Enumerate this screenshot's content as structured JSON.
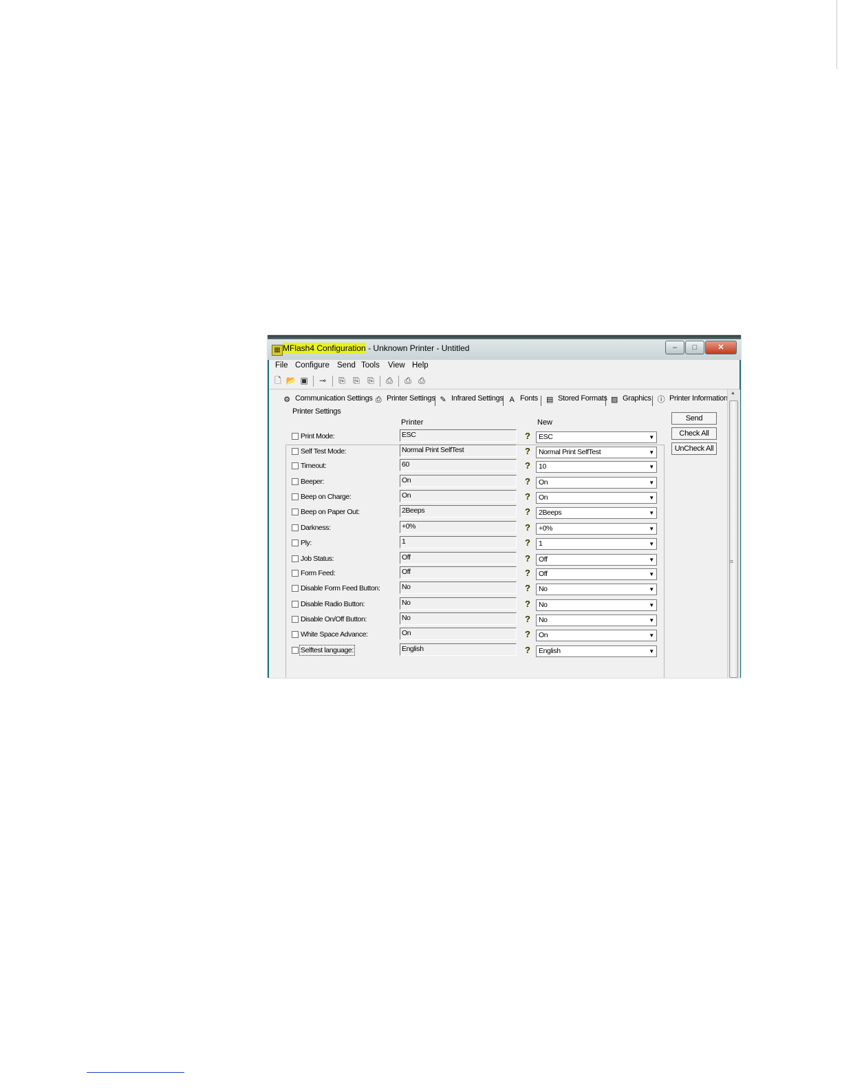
{
  "window": {
    "title_highlight": "MFlash4 Configuration",
    "title_rest": " - Unknown Printer - Untitled",
    "app_icon": "printer-app-icon"
  },
  "menu": [
    "File",
    "Configure",
    "Send",
    "Tools",
    "View",
    "Help"
  ],
  "tabs": [
    {
      "label": "Communication Settings",
      "icon": "communication-icon"
    },
    {
      "label": "Printer Settings",
      "icon": "printer-icon"
    },
    {
      "label": "Infrared Settings",
      "icon": "infrared-icon"
    },
    {
      "label": "Fonts",
      "icon": "fonts-icon"
    },
    {
      "label": "Stored Formats",
      "icon": "stored-formats-icon"
    },
    {
      "label": "Graphics",
      "icon": "graphics-icon"
    },
    {
      "label": "Printer Information",
      "icon": "info-icon"
    }
  ],
  "group": {
    "label": "Printer Settings",
    "col_printer": "Printer",
    "col_new": "New"
  },
  "buttons": {
    "send": "Send",
    "check_all": "Check All",
    "uncheck_all": "UnCheck All"
  },
  "settings": [
    {
      "label": "Print Mode:",
      "printer": "ESC",
      "new": "ESC"
    },
    {
      "label": "Self Test Mode:",
      "printer": "Normal Print SelfTest",
      "new": "Normal Print SelfTest"
    },
    {
      "label": "Timeout:",
      "printer": "60",
      "new": "10"
    },
    {
      "label": "Beeper:",
      "printer": "On",
      "new": "On"
    },
    {
      "label": "Beep on Charge:",
      "printer": "On",
      "new": "On"
    },
    {
      "label": "Beep on Paper Out:",
      "printer": "2Beeps",
      "new": "2Beeps"
    },
    {
      "label": "Darkness:",
      "printer": "+0%",
      "new": "+0%"
    },
    {
      "label": "Ply:",
      "printer": "1",
      "new": "1"
    },
    {
      "label": "Job Status:",
      "printer": "Off",
      "new": "Off"
    },
    {
      "label": "Form Feed:",
      "printer": "Off",
      "new": "Off"
    },
    {
      "label": "Disable Form Feed Button:",
      "printer": "No",
      "new": "No"
    },
    {
      "label": "Disable Radio Button:",
      "printer": "No",
      "new": "No"
    },
    {
      "label": "Disable On/Off Button:",
      "printer": "No",
      "new": "No"
    },
    {
      "label": "White Space Advance:",
      "printer": "On",
      "new": "On"
    },
    {
      "label": "Selftest language:",
      "printer": "English",
      "new": "English"
    }
  ]
}
